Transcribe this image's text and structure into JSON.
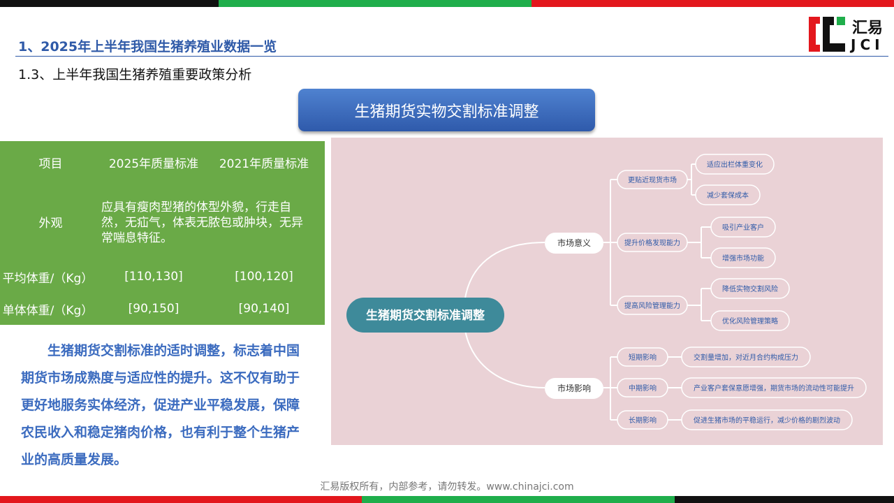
{
  "header": {
    "title": "1、2025年上半年我国生猪养殖业数据一览",
    "subtitle": "1.3、上半年我国生猪养殖重要政策分析"
  },
  "logo": {
    "cn": "汇易",
    "en": "JCI"
  },
  "banner": {
    "text": "生猪期货实物交割标准调整"
  },
  "table": {
    "headers": [
      "项目",
      "2025年质量标准",
      "2021年质量标准"
    ],
    "rows": [
      {
        "label": "外观",
        "merged": "应具有瘦肉型猪的体型外貌，行走自然，无疝气，体表无脓包或肿块，无异常喘息特征。"
      },
      {
        "label": "平均体重/（Kg）",
        "v2025": "[110,130]",
        "v2021": "[100,120]"
      },
      {
        "label": "单体体重/（Kg）",
        "v2025": "[90,150]",
        "v2021": "[90,140]"
      }
    ]
  },
  "summary": "生猪期货交割标准的适时调整，标志着中国期货市场成熟度与适应性的提升。这不仅有助于更好地服务实体经济，促进产业平稳发展，保障农民收入和稳定猪肉价格，也有利于整个生猪产业的高质量发展。",
  "mindmap": {
    "root": "生猪期货交割标准调整",
    "branch1": {
      "label": "市场意义",
      "sub": [
        {
          "label": "更贴近现货市场",
          "leaves": [
            "适应出栏体重变化",
            "减少套保成本"
          ]
        },
        {
          "label": "提升价格发现能力",
          "leaves": [
            "吸引产业客户",
            "增强市场功能"
          ]
        },
        {
          "label": "提高风险管理能力",
          "leaves": [
            "降低实物交割风险",
            "优化风险管理策略"
          ]
        }
      ]
    },
    "branch2": {
      "label": "市场影响",
      "sub": [
        {
          "label": "短期影响",
          "leaves": [
            "交割量增加，对近月合约构成压力"
          ]
        },
        {
          "label": "中期影响",
          "leaves": [
            "产业客户套保意愿增强，期货市场的流动性可能提升"
          ]
        },
        {
          "label": "长期影响",
          "leaves": [
            "促进生猪市场的平稳运行，减少价格的剧烈波动"
          ]
        }
      ]
    }
  },
  "footer": "汇易版权所有，内部参考，请勿转发。www.chinajci.com",
  "colors": {
    "green": "#1fae4b",
    "red": "#e3171d",
    "black": "#111111",
    "title_blue": "#2f5aa8"
  }
}
